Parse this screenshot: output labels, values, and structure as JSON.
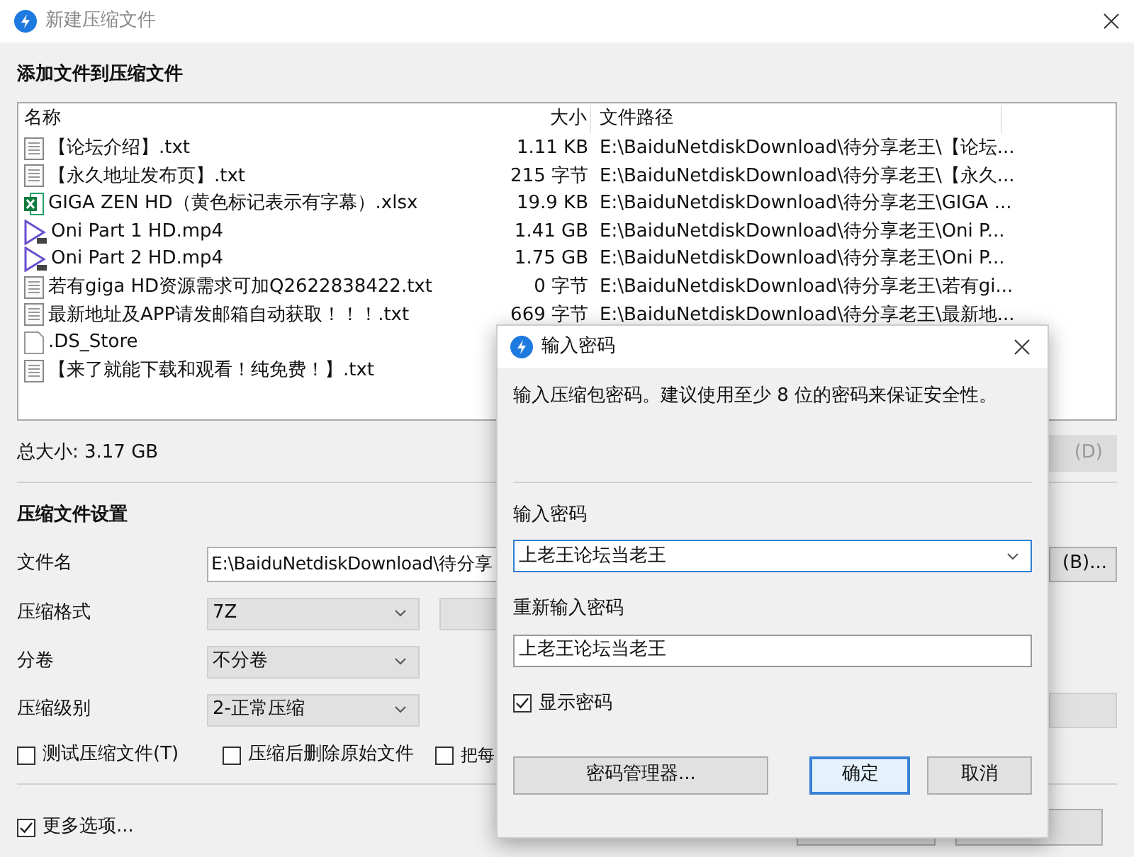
{
  "window": {
    "title": "新建压缩文件"
  },
  "add_section": {
    "heading": "添加文件到压缩文件"
  },
  "file_list": {
    "columns": [
      "名称",
      "大小",
      "文件路径"
    ],
    "rows": [
      {
        "kind": "text",
        "name": "【论坛介绍】.txt",
        "size": "1.11 KB",
        "path": "E:\\BaiduNetdiskDownload\\待分享老王\\【论坛..."
      },
      {
        "kind": "text",
        "name": "【永久地址发布页】.txt",
        "size": "215 字节",
        "path": "E:\\BaiduNetdiskDownload\\待分享老王\\【永久..."
      },
      {
        "kind": "excel",
        "name": "GIGA ZEN HD（黄色标记表示有字幕）.xlsx",
        "size": "19.9 KB",
        "path": "E:\\BaiduNetdiskDownload\\待分享老王\\GIGA ..."
      },
      {
        "kind": "video",
        "name": "Oni Part 1 HD.mp4",
        "size": "1.41 GB",
        "path": "E:\\BaiduNetdiskDownload\\待分享老王\\Oni P..."
      },
      {
        "kind": "video",
        "name": "Oni Part 2 HD.mp4",
        "size": "1.75 GB",
        "path": "E:\\BaiduNetdiskDownload\\待分享老王\\Oni P..."
      },
      {
        "kind": "text",
        "name": "若有giga HD资源需求可加Q2622838422.txt",
        "size": "0 字节",
        "path": "E:\\BaiduNetdiskDownload\\待分享老王\\若有gi..."
      },
      {
        "kind": "text",
        "name": "最新地址及APP请发邮箱自动获取！！！.txt",
        "size": "669 字节",
        "path": "E:\\BaiduNetdiskDownload\\待分享老王\\最新地..."
      },
      {
        "kind": "blank",
        "name": ".DS_Store"
      },
      {
        "kind": "text",
        "name": "【来了就能下载和观看！纯免费！】.txt"
      }
    ]
  },
  "total_size": "总大小: 3.17 GB",
  "delete_button": {
    "label": "(D)",
    "disabled": true
  },
  "settings": {
    "heading": "压缩文件设置",
    "file_name": {
      "label": "文件名",
      "value": "E:\\BaiduNetdiskDownload\\待分享",
      "browse_label": "(B)..."
    },
    "format": {
      "label": "压缩格式",
      "value": "7Z"
    },
    "split": {
      "label": "分卷",
      "value": "不分卷"
    },
    "level": {
      "label": "压缩级别",
      "value": "2-正常压缩"
    },
    "options": [
      {
        "label": "测试压缩文件(T)",
        "checked": false
      },
      {
        "label": "压缩后删除原始文件",
        "checked": false
      },
      {
        "label": "把每",
        "checked": false
      }
    ],
    "more_options": {
      "label": "更多选项...",
      "checked": true
    }
  },
  "password_dialog": {
    "title": "输入密码",
    "description": "输入压缩包密码。建议使用至少 8 位的密码来保证安全性。",
    "password_label": "输入密码",
    "password_value": "上老王论坛当老王",
    "confirm_label": "重新输入密码",
    "confirm_value": "上老王论坛当老王",
    "show_password": {
      "label": "显示密码",
      "checked": true
    },
    "buttons": [
      {
        "label": "密码管理器...",
        "default": false
      },
      {
        "label": "确定",
        "default": true
      },
      {
        "label": "取消",
        "default": false
      }
    ]
  }
}
